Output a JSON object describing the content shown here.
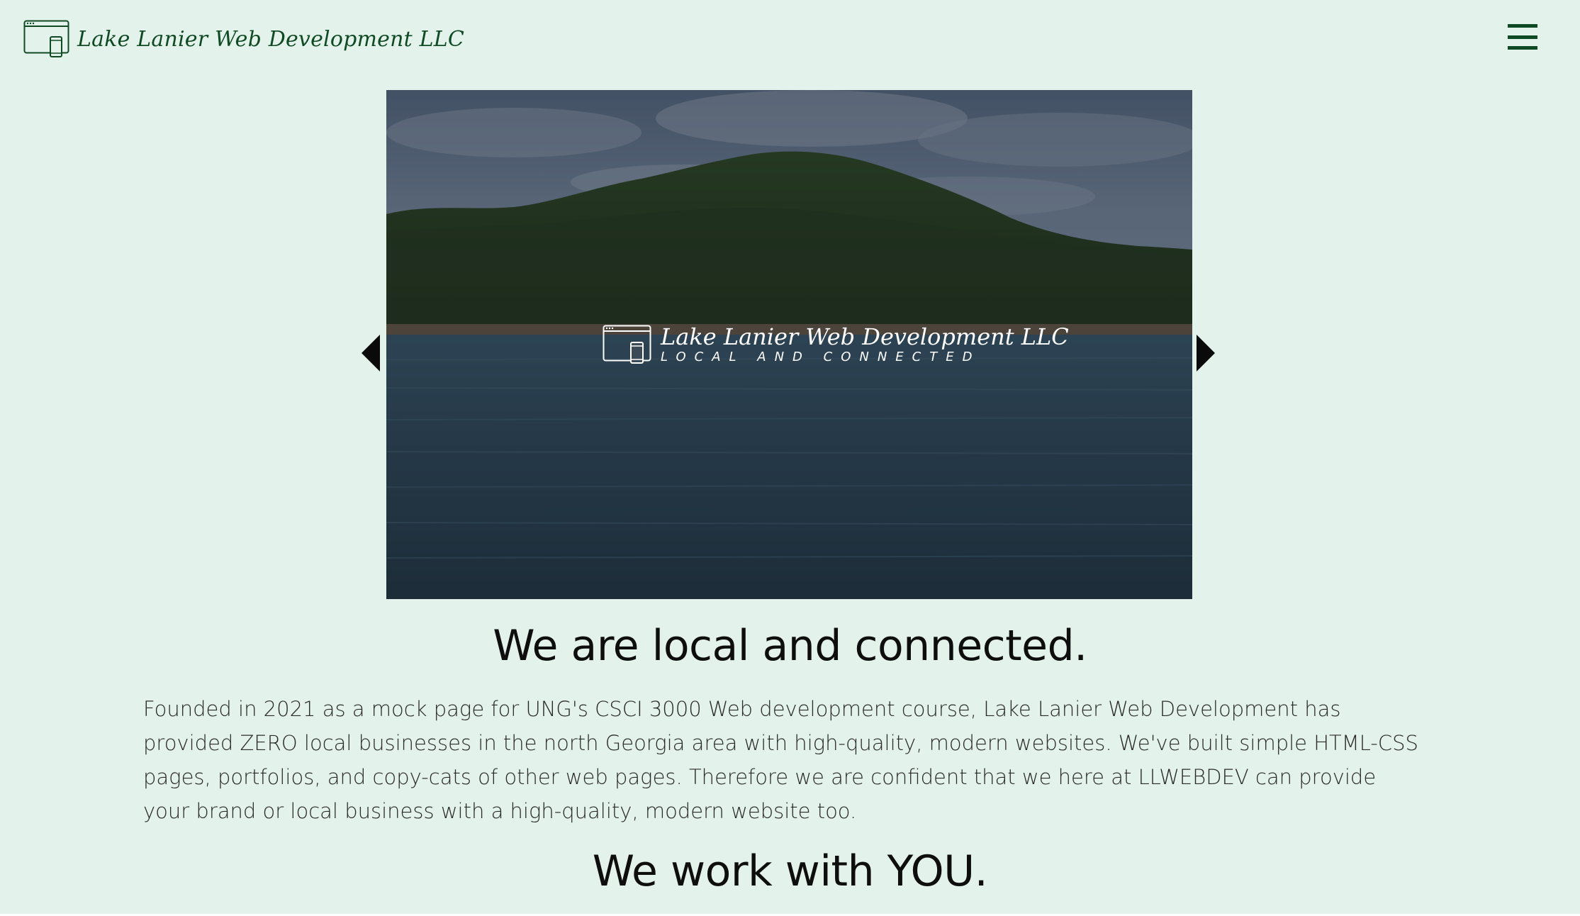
{
  "header": {
    "brand_name": "Lake Lanier Web Development LLC",
    "brand_icon": "browser-mobile-icon",
    "menu_icon": "hamburger-menu-icon"
  },
  "carousel": {
    "slide_title": "Lake Lanier Web Development LLC",
    "slide_subtitle": "LOCAL AND CONNECTED",
    "slide_icon": "browser-mobile-icon",
    "prev_icon": "chevron-left-icon",
    "next_icon": "chevron-right-icon"
  },
  "main": {
    "heading_1": "We are local and connected.",
    "paragraph": "Founded in 2021 as a mock page for UNG's CSCI 3000 Web development course, Lake Lanier Web Development has provided ZERO local businesses in the north Georgia area with high-quality, modern websites. We've built simple HTML-CSS pages, portfolios, and copy-cats of other web pages. Therefore we are confident that we here at LLWEBDEV can provide your brand or local business with a high-quality, modern website too.",
    "heading_2": "We work with YOU."
  },
  "colors": {
    "background": "#e3f2ea",
    "brand": "#0f4a24",
    "text": "#111111"
  }
}
